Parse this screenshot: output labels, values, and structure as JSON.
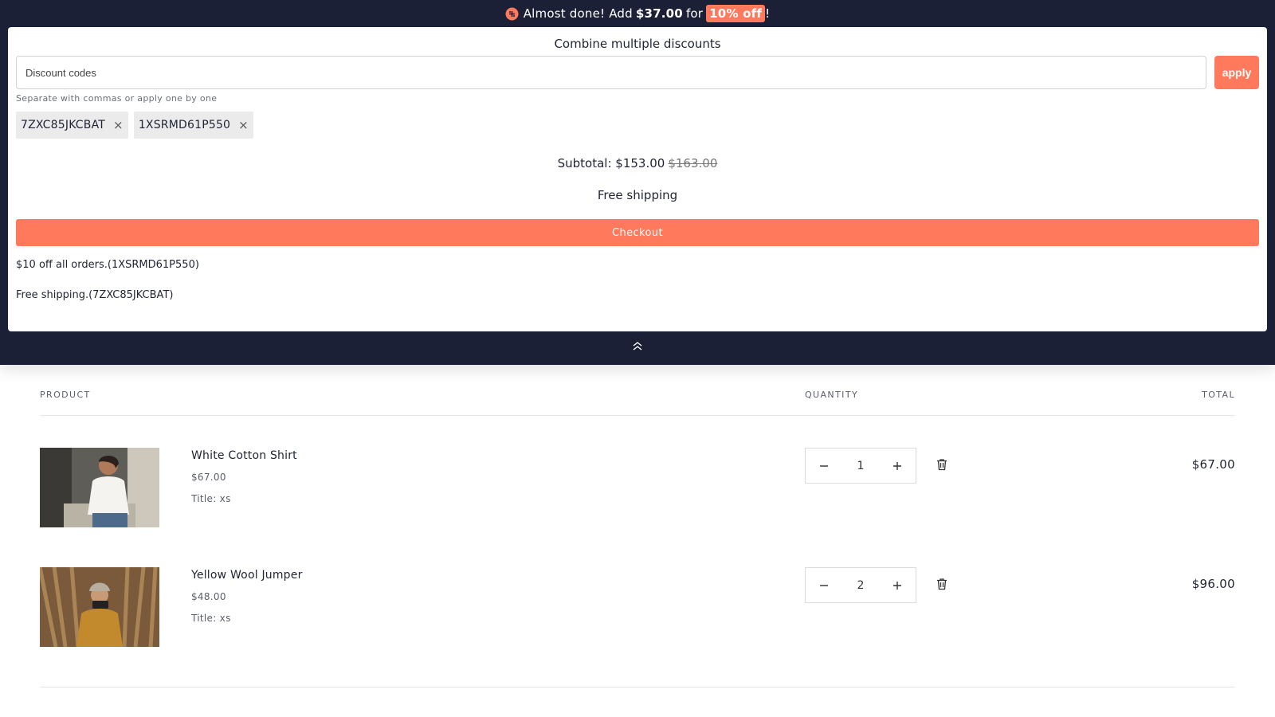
{
  "banner": {
    "prefix": "Almost done! Add",
    "amount": "$37.00",
    "for": "for",
    "badge": "10% off",
    "suffix": "!",
    "gift_icon": "gift-icon",
    "accent": "#ff7a5c",
    "background": "#1c2036"
  },
  "discount_panel": {
    "title": "Combine multiple discounts",
    "input_placeholder": "Discount codes",
    "input_value": "",
    "apply_label": "apply",
    "hint": "Separate with commas or apply one by one",
    "tags": [
      {
        "code": "7ZXC85JKCBAT",
        "remove": "×"
      },
      {
        "code": "1XSRMD61P550",
        "remove": "×"
      }
    ],
    "subtotal_label": "Subtotal: $153.00",
    "subtotal_old": "$163.00",
    "shipping": "Free shipping",
    "checkout_label": "Checkout",
    "applied": [
      "$10 off all orders.(1XSRMD61P550)",
      "Free shipping.(7ZXC85JKCBAT)"
    ]
  },
  "cart": {
    "headers": {
      "product": "PRODUCT",
      "quantity": "QUANTITY",
      "total": "TOTAL"
    },
    "items": [
      {
        "name": "White Cotton Shirt",
        "price": "$67.00",
        "variant": "Title: xs",
        "quantity": "1",
        "total": "$67.00"
      },
      {
        "name": "Yellow Wool Jumper",
        "price": "$48.00",
        "variant": "Title: xs",
        "quantity": "2",
        "total": "$96.00"
      }
    ]
  }
}
